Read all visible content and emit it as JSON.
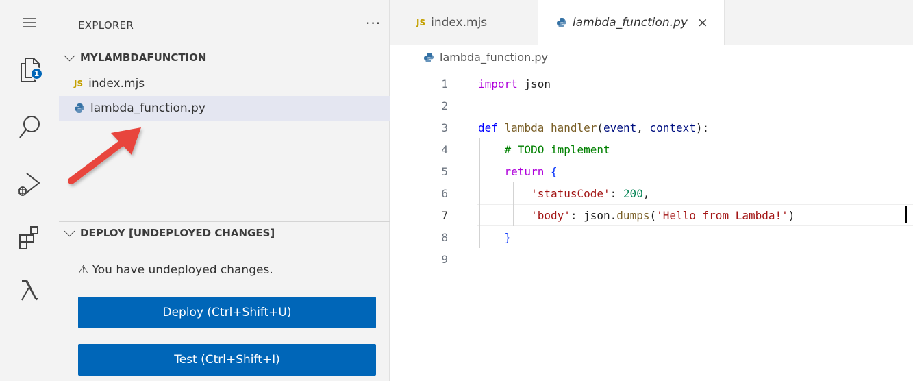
{
  "activity_bar": {
    "explorer_badge": "1",
    "icons": [
      "menu-icon",
      "explorer-icon",
      "search-icon",
      "run-debug-icon",
      "extensions-icon",
      "lambda-icon"
    ]
  },
  "sidebar": {
    "title": "EXPLORER",
    "more": "···",
    "folder": "MYLAMBDAFUNCTION",
    "files": [
      {
        "label": "index.mjs",
        "icon": "js-icon"
      },
      {
        "label": "lambda_function.py",
        "icon": "python-icon",
        "selected": true
      }
    ],
    "deploy_section": "DEPLOY [UNDEPLOYED CHANGES]",
    "deploy_message": "⚠ You have undeployed changes.",
    "deploy_button": "Deploy (Ctrl+Shift+U)",
    "test_button": "Test (Ctrl+Shift+I)"
  },
  "editor": {
    "tabs": [
      {
        "label": "index.mjs",
        "icon": "js-icon",
        "active": false
      },
      {
        "label": "lambda_function.py",
        "icon": "python-icon",
        "active": true
      }
    ],
    "tab_close": "×",
    "breadcrumb": "lambda_function.py",
    "current_line": "7",
    "line_numbers": [
      "1",
      "2",
      "3",
      "4",
      "5",
      "6",
      "7",
      "8",
      "9"
    ]
  },
  "colors": {
    "accent": "#0066b8",
    "sidebar_bg": "#f3f3f3",
    "selected_bg": "#e4e6f1",
    "arrow": "#e8453c"
  }
}
